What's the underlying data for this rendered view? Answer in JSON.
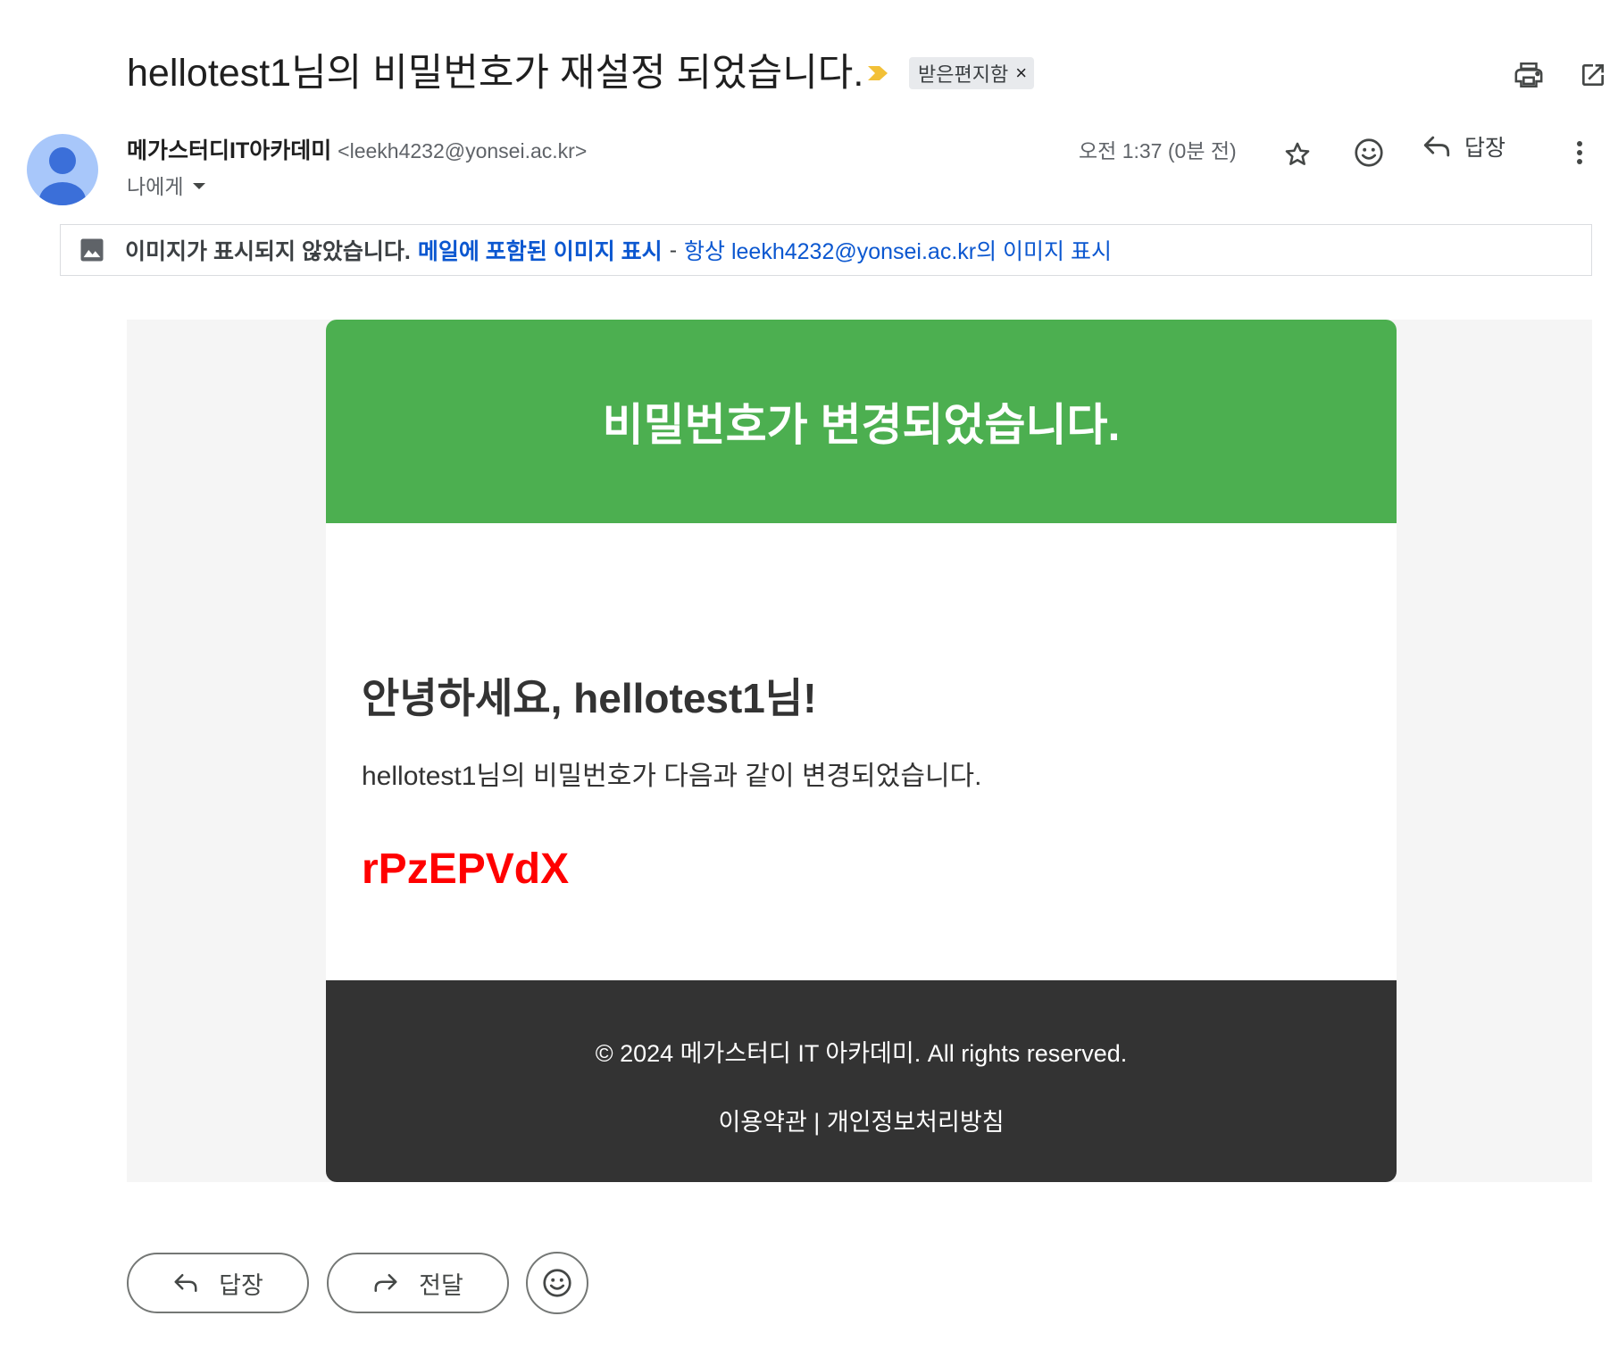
{
  "subject": "hellotest1님의 비밀번호가 재설정 되었습니다.",
  "label": "받은편지함",
  "label_remove": "×",
  "sender": {
    "name": "메가스터디IT아카데미",
    "email": "<leekh4232@yonsei.ac.kr>",
    "recipient": "나에게"
  },
  "time": "오전 1:37 (0분 전)",
  "reply_label": "답장",
  "image_bar": {
    "notice": "이미지가 표시되지 않았습니다.",
    "show_link": "메일에 포함된 이미지 표시",
    "separator": "-",
    "always_link": "항상 leekh4232@yonsei.ac.kr의 이미지 표시"
  },
  "email": {
    "header": "비밀번호가 변경되었습니다.",
    "greeting": "안녕하세요, hellotest1님!",
    "message": "hellotest1님의 비밀번호가 다음과 같이 변경되었습니다.",
    "password": "rPzEPVdX",
    "copyright": "© 2024 메가스터디 IT 아카데미. All rights reserved.",
    "footer_links": "이용약관 | 개인정보처리방침"
  },
  "bottom": {
    "reply": "답장",
    "forward": "전달"
  },
  "colors": {
    "header_green": "#4caf50",
    "footer_dark": "#333333",
    "password_red": "#ff0000",
    "link_blue": "#0b57d0",
    "importance_yellow": "#f2c037"
  },
  "icons": {
    "importance": "importance-marker-icon",
    "print": "print-icon",
    "open_new": "open-in-new-window-icon",
    "star": "star-icon",
    "emoji": "emoji-reaction-icon",
    "reply": "reply-icon",
    "forward": "forward-icon",
    "more": "more-vert-icon",
    "image": "image-icon",
    "dropdown": "dropdown-caret-icon"
  }
}
